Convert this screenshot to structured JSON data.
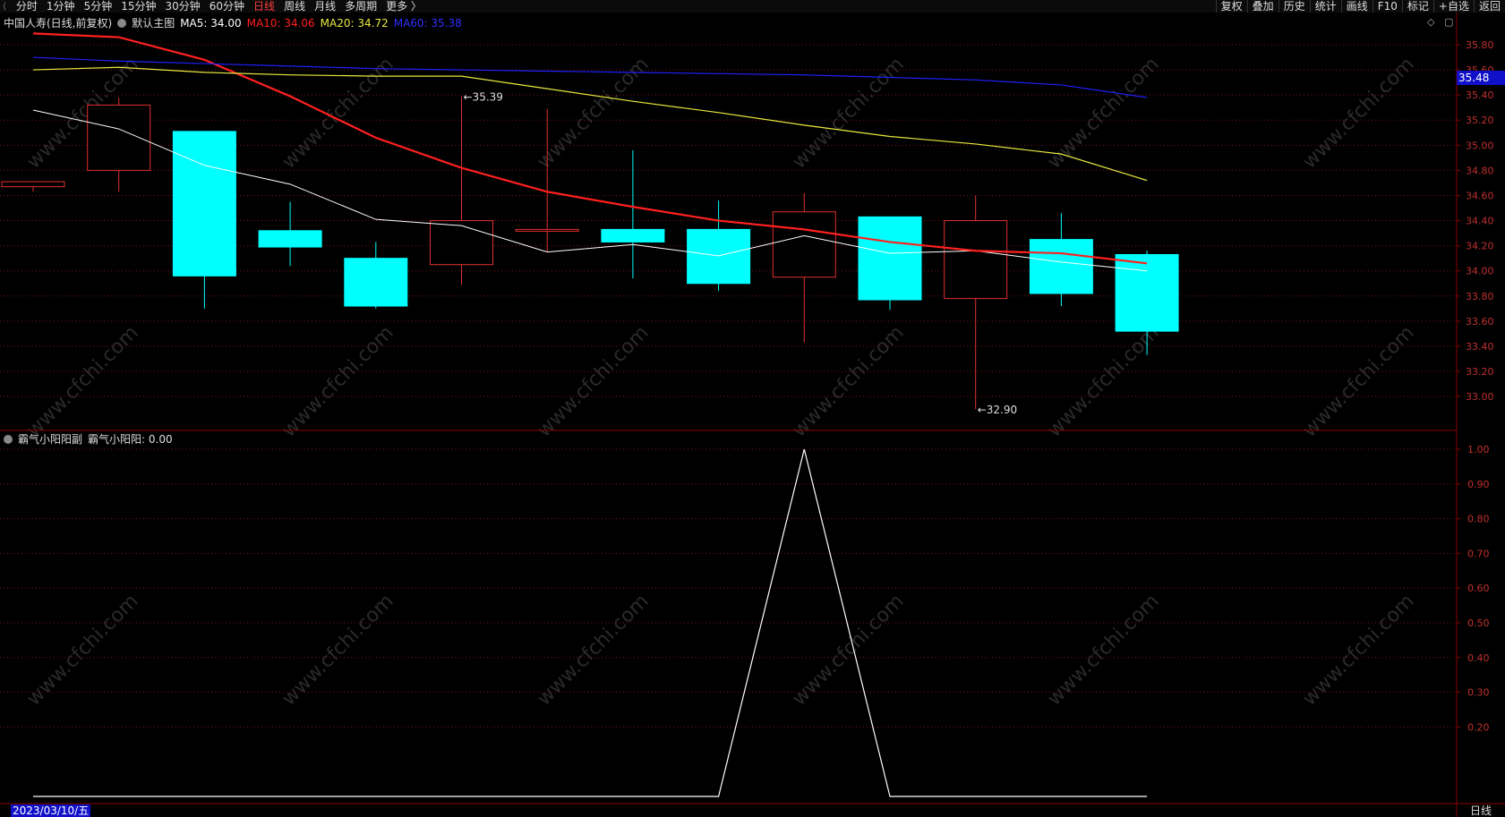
{
  "topbar": {
    "periods": [
      "分时",
      "1分钟",
      "5分钟",
      "15分钟",
      "30分钟",
      "60分钟",
      "日线",
      "周线",
      "月线",
      "多周期",
      "更多 〉"
    ],
    "active_period": "日线",
    "right_buttons": [
      "复权",
      "叠加",
      "历史",
      "统计",
      "画线",
      "F10",
      "标记",
      "+自选",
      "返回"
    ]
  },
  "main_legend": {
    "stock": "中国人寿(日线,前复权)",
    "template": "默认主图",
    "ma5": "MA5: 34.00",
    "ma10": "MA10: 34.06",
    "ma20": "MA20: 34.72",
    "ma60": "MA60: 35.38"
  },
  "sub_legend": {
    "indicator": "霸气小阳阳副",
    "value": "霸气小阳阳: 0.00"
  },
  "price_flag": "35.48",
  "annotations": {
    "high": "35.39",
    "low": "32.90"
  },
  "bottom": {
    "date": "2023/03/10/五",
    "period": "日线"
  },
  "watermark": "www.cfchi.com",
  "colors": {
    "up": "#e03030",
    "down": "#00ffff",
    "ma5": "#ffffff",
    "ma10": "#ff2020",
    "ma20": "#e8e840",
    "ma60": "#2020ff",
    "axis": "#8b0000",
    "grid": "#7a1515"
  },
  "chart_data": [
    {
      "type": "candlestick",
      "title": "中国人寿(日线,前复权)",
      "ylim": [
        32.8,
        36.0
      ],
      "ticks": [
        "35.80",
        "35.60",
        "35.40",
        "35.20",
        "35.00",
        "34.80",
        "34.60",
        "34.40",
        "34.20",
        "34.00",
        "33.80",
        "33.60",
        "33.40",
        "33.20",
        "33.00"
      ],
      "candles": [
        {
          "o": 34.67,
          "h": 34.7,
          "l": 34.63,
          "c": 34.71
        },
        {
          "o": 34.8,
          "h": 35.38,
          "l": 34.63,
          "c": 35.32
        },
        {
          "o": 35.11,
          "h": 35.11,
          "l": 33.7,
          "c": 33.96
        },
        {
          "o": 34.32,
          "h": 34.55,
          "l": 34.04,
          "c": 34.19
        },
        {
          "o": 34.1,
          "h": 34.23,
          "l": 33.7,
          "c": 33.72
        },
        {
          "o": 34.05,
          "h": 35.39,
          "l": 33.89,
          "c": 34.4
        },
        {
          "o": 34.32,
          "h": 35.29,
          "l": 34.15,
          "c": 34.33
        },
        {
          "o": 34.33,
          "h": 34.96,
          "l": 33.94,
          "c": 34.23
        },
        {
          "o": 34.33,
          "h": 34.56,
          "l": 33.84,
          "c": 33.9
        },
        {
          "o": 33.95,
          "h": 34.62,
          "l": 33.43,
          "c": 34.47
        },
        {
          "o": 34.43,
          "h": 34.43,
          "l": 33.69,
          "c": 33.77
        },
        {
          "o": 33.78,
          "h": 34.6,
          "l": 32.9,
          "c": 34.4
        },
        {
          "o": 34.25,
          "h": 34.46,
          "l": 33.72,
          "c": 33.82
        },
        {
          "o": 34.13,
          "h": 34.16,
          "l": 33.33,
          "c": 33.52
        }
      ],
      "series": [
        {
          "name": "MA5",
          "values": [
            35.28,
            35.13,
            34.84,
            34.69,
            34.41,
            34.36,
            34.15,
            34.21,
            34.12,
            34.28,
            34.14,
            34.16,
            34.07,
            34.0
          ]
        },
        {
          "name": "MA10",
          "values": [
            35.89,
            35.86,
            35.68,
            35.39,
            35.06,
            34.82,
            34.63,
            34.51,
            34.4,
            34.33,
            34.23,
            34.16,
            34.14,
            34.06
          ]
        },
        {
          "name": "MA20",
          "values": [
            35.6,
            35.62,
            35.58,
            35.56,
            35.55,
            35.55,
            35.45,
            35.35,
            35.26,
            35.16,
            35.07,
            35.01,
            34.93,
            34.72
          ]
        },
        {
          "name": "MA60",
          "values": [
            35.7,
            35.67,
            35.65,
            35.63,
            35.61,
            35.6,
            35.59,
            35.58,
            35.57,
            35.56,
            35.54,
            35.52,
            35.48,
            35.38
          ]
        }
      ]
    },
    {
      "type": "line",
      "title": "霸气小阳阳副",
      "ylim": [
        0,
        1.0
      ],
      "ticks": [
        "1.00",
        "0.90",
        "0.80",
        "0.70",
        "0.60",
        "0.50",
        "0.40",
        "0.30",
        "0.20"
      ],
      "series": [
        {
          "name": "霸气小阳阳",
          "values": [
            0,
            0,
            0,
            0,
            0,
            0,
            0,
            0,
            0,
            1,
            0,
            0,
            0,
            0
          ]
        }
      ]
    }
  ]
}
